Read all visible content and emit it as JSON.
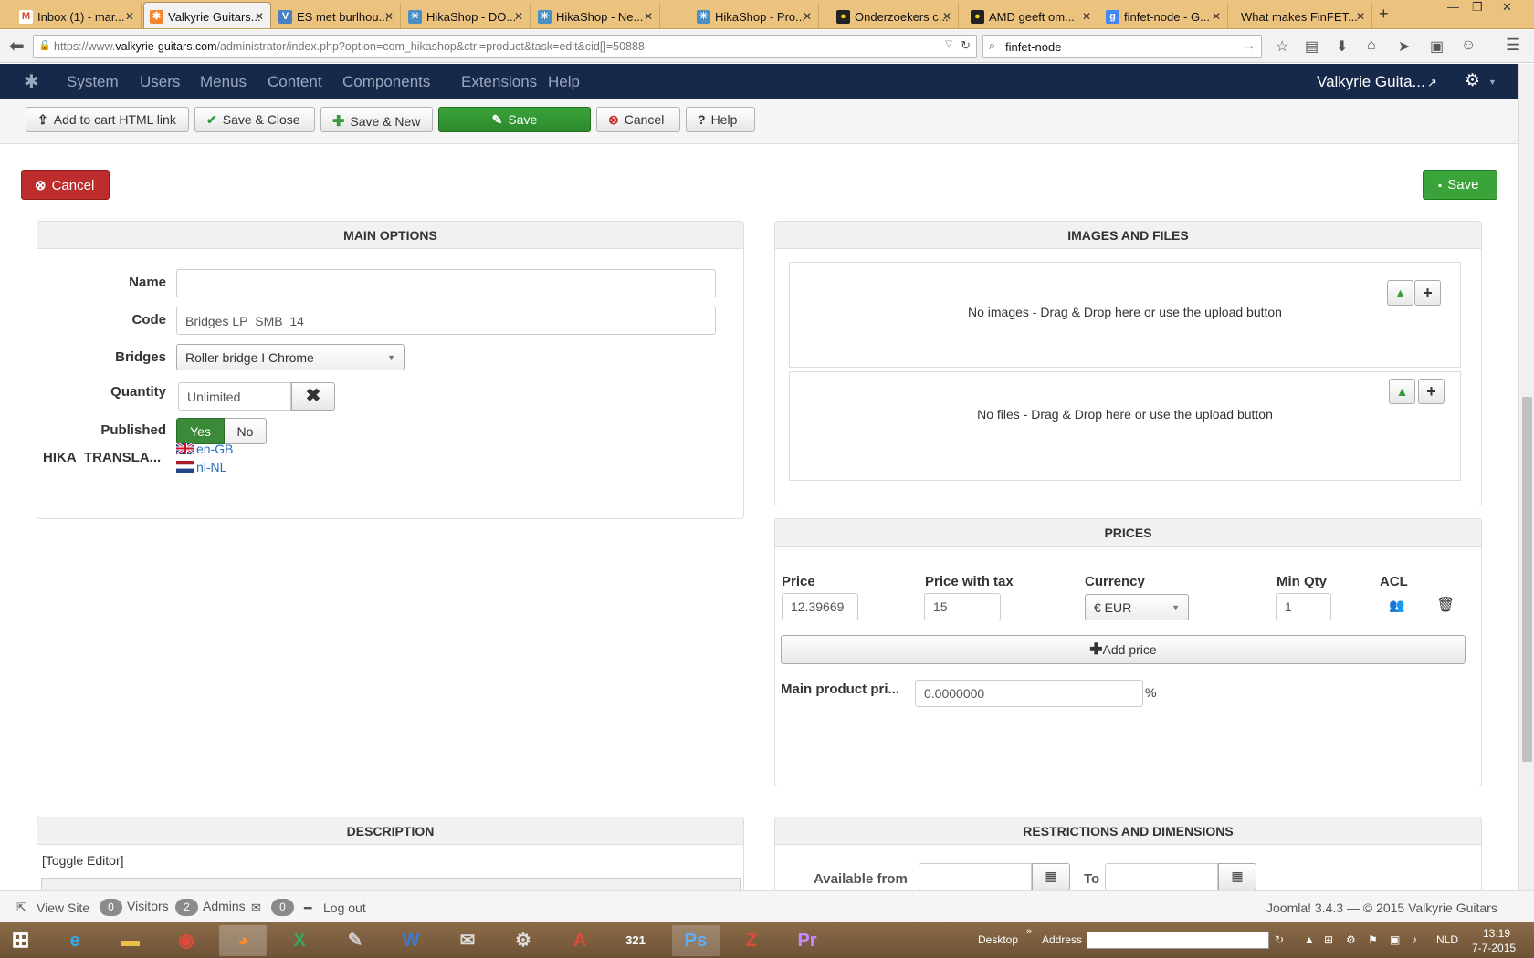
{
  "browser": {
    "tabs": [
      {
        "label": "Inbox (1) - mar...",
        "icon": "gmail-icon",
        "color": "#d14836",
        "glyph": "M"
      },
      {
        "label": "Valkyrie Guitars...",
        "icon": "joomla-icon",
        "color": "#f2852d",
        "glyph": "✱",
        "active": true
      },
      {
        "label": "ES met burlhou...",
        "icon": "valkyrie-icon",
        "color": "#4a7fc1",
        "glyph": "V"
      },
      {
        "label": "HikaShop - DO...",
        "icon": "hikashop-icon",
        "color": "#4a8fc1",
        "glyph": "✳"
      },
      {
        "label": "HikaShop - Ne...",
        "icon": "hikashop-icon",
        "color": "#4a8fc1",
        "glyph": "✳"
      },
      {
        "label": "HikaShop - Pro...",
        "icon": "hikashop-icon",
        "color": "#4a8fc1",
        "glyph": "✳"
      },
      {
        "label": "Onderzoekers c...",
        "icon": "tweakers-icon",
        "color": "#222",
        "glyph": "●"
      },
      {
        "label": "AMD geeft om...",
        "icon": "tweakers-icon",
        "color": "#222",
        "glyph": "●"
      },
      {
        "label": "finfet-node - G...",
        "icon": "google-icon",
        "color": "#4285f4",
        "glyph": "g"
      },
      {
        "label": "What makes FinFET...",
        "icon": "",
        "color": "",
        "glyph": ""
      }
    ],
    "url_prefix": "https://www.",
    "url_domain": "valkyrie-guitars.com",
    "url_path": "/administrator/index.php?option=com_hikashop&ctrl=product&task=edit&cid[]=50888",
    "search_value": "finfet-node"
  },
  "joomla_menu": {
    "items": [
      "System",
      "Users",
      "Menus",
      "Content",
      "Components",
      "Extensions",
      "Help"
    ],
    "site_name": "Valkyrie Guita..."
  },
  "toolbar": {
    "add_to_cart": "Add to cart HTML link",
    "save_close": "Save & Close",
    "save_new": "Save & New",
    "save": "Save",
    "cancel": "Cancel",
    "help": "Help"
  },
  "form": {
    "cancel": "Cancel",
    "save": "Save",
    "main_options": {
      "title": "MAIN OPTIONS",
      "name_label": "Name",
      "name_value": "",
      "code_label": "Code",
      "code_value": "Bridges LP_SMB_14",
      "bridges_label": "Bridges",
      "bridges_value": "Roller bridge I Chrome",
      "quantity_label": "Quantity",
      "quantity_value": "Unlimited",
      "published_label": "Published",
      "published_yes": "Yes",
      "published_no": "No",
      "translations_label": "HIKA_TRANSLA...",
      "lang1": "en-GB",
      "lang2": "nl-NL"
    },
    "images_files": {
      "title": "IMAGES AND FILES",
      "no_images": "No images - Drag & Drop here or use the upload button",
      "no_files": "No files - Drag & Drop here or use the upload button"
    },
    "prices": {
      "title": "PRICES",
      "col_price": "Price",
      "col_price_tax": "Price with tax",
      "col_currency": "Currency",
      "col_min_qty": "Min Qty",
      "col_acl": "ACL",
      "price": "12.39669",
      "price_tax": "15",
      "currency": "€ EUR",
      "min_qty": "1",
      "add_price": "Add price",
      "main_product_label": "Main product pri...",
      "main_product_value": "0.0000000",
      "percent": "%"
    },
    "description": {
      "title": "DESCRIPTION",
      "toggle": "[Toggle Editor]"
    },
    "restrictions": {
      "title": "RESTRICTIONS AND DIMENSIONS",
      "available_from": "Available from",
      "to": "To"
    }
  },
  "status": {
    "view_site": "View Site",
    "visitors_count": "0",
    "visitors": "Visitors",
    "admins_count": "2",
    "admins": "Admins",
    "mail_count": "0",
    "logout": "Log out",
    "version": "Joomla! 3.4.3  —  © 2015 Valkyrie Guitars"
  },
  "taskbar": {
    "desktop": "Desktop",
    "address": "Address",
    "lang": "NLD",
    "time": "13:19",
    "date": "7-7-2015"
  }
}
